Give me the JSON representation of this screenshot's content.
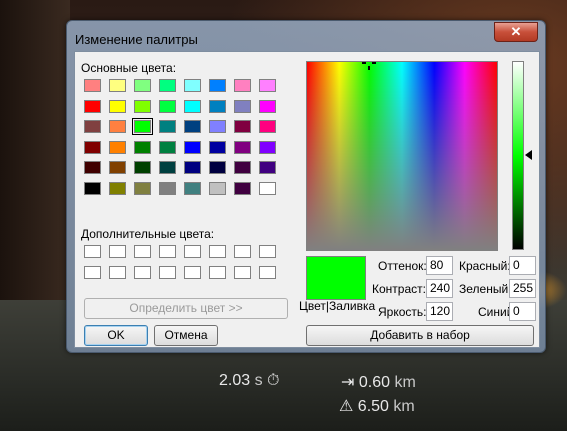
{
  "dialog": {
    "title": "Изменение палитры",
    "close_label": "✕",
    "basic_colors_label": "Основные цвета:",
    "custom_colors_label": "Дополнительные цвета:",
    "define_button": "Определить цвет >>",
    "ok_button": "OK",
    "cancel_button": "Отмена",
    "color_solid_label": "Цвет|Заливка",
    "add_button": "Добавить в набор",
    "preview_color": "#00ff00",
    "selected_basic_index": 18,
    "luminance_fraction": 0.5,
    "fields": {
      "hue_label": "Оттенок:",
      "hue": "80",
      "sat_label": "Контраст:",
      "sat": "240",
      "lum_label": "Яркость:",
      "lum": "120",
      "red_label": "Красный:",
      "red": "0",
      "green_label": "Зеленый:",
      "green": "255",
      "blue_label": "Синий:",
      "blue": "0"
    },
    "basic_colors": [
      "#ff8080",
      "#ffff80",
      "#80ff80",
      "#00ff80",
      "#80ffff",
      "#0080ff",
      "#ff80c0",
      "#ff80ff",
      "#ff0000",
      "#ffff00",
      "#80ff00",
      "#00ff40",
      "#00ffff",
      "#0080c0",
      "#8080c0",
      "#ff00ff",
      "#804040",
      "#ff8040",
      "#00ff00",
      "#008080",
      "#004080",
      "#8080ff",
      "#800040",
      "#ff0080",
      "#800000",
      "#ff8000",
      "#008000",
      "#008040",
      "#0000ff",
      "#0000a0",
      "#800080",
      "#8000ff",
      "#400000",
      "#804000",
      "#004000",
      "#004040",
      "#000080",
      "#000040",
      "#400040",
      "#400080",
      "#000000",
      "#808000",
      "#808040",
      "#808080",
      "#408080",
      "#c0c0c0",
      "#400040",
      "#ffffff"
    ],
    "custom_colors": [
      "#ffffff",
      "#ffffff",
      "#ffffff",
      "#ffffff",
      "#ffffff",
      "#ffffff",
      "#ffffff",
      "#ffffff",
      "#ffffff",
      "#ffffff",
      "#ffffff",
      "#ffffff",
      "#ffffff",
      "#ffffff",
      "#ffffff",
      "#ffffff"
    ]
  },
  "hud": {
    "time_value": "2.03",
    "time_unit": "s",
    "time_icon": "⏱",
    "distance_value": "0.60",
    "distance_unit": "km",
    "distance_icon": "⇥",
    "warning_value": "6.50",
    "warning_unit": "km",
    "warning_icon": "⚠"
  }
}
